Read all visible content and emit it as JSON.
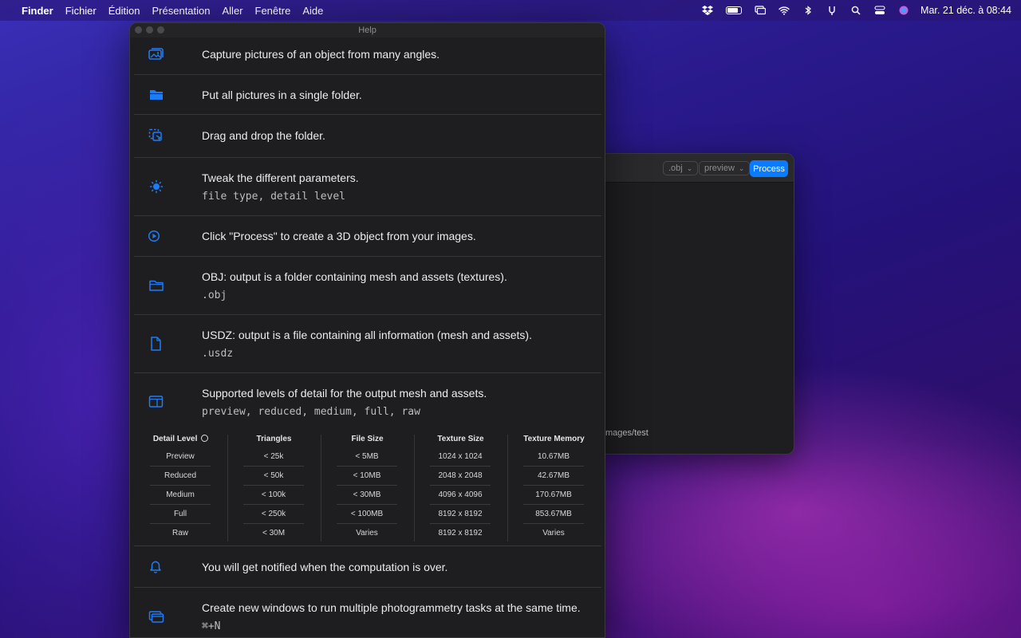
{
  "menubar": {
    "app": "Finder",
    "items": [
      "Fichier",
      "Édition",
      "Présentation",
      "Aller",
      "Fenêtre",
      "Aide"
    ],
    "clock": "Mar. 21 déc. à  08:44",
    "status_icons": [
      "dropbox-icon",
      "battery-icon",
      "screen-mirror-icon",
      "wifi-icon",
      "bluetooth-icon",
      "tuning-fork-icon",
      "spotlight-icon",
      "control-center-icon",
      "siri-icon"
    ]
  },
  "back_window": {
    "format_select": ".obj",
    "detail_select": "preview",
    "process_label": "Process",
    "path_text": "mages/test"
  },
  "help": {
    "title": "Help",
    "rows": [
      {
        "icon": "photos-icon",
        "text": "Capture pictures of an object from many angles.",
        "mono": ""
      },
      {
        "icon": "folder-filled-icon",
        "text": "Put all pictures in a single folder.",
        "mono": ""
      },
      {
        "icon": "drag-drop-icon",
        "text": "Drag and drop the folder.",
        "mono": ""
      },
      {
        "icon": "adjust-icon",
        "text": "Tweak the different parameters.",
        "mono": "file type, detail level"
      },
      {
        "icon": "play-circle-icon",
        "text": "Click \"Process\" to create a 3D object from your images.",
        "mono": ""
      },
      {
        "icon": "folder-outline-icon",
        "text": "OBJ: output is a folder containing mesh and assets (textures).",
        "mono": ".obj"
      },
      {
        "icon": "document-icon",
        "text": "USDZ: output is a file containing all information (mesh and assets).",
        "mono": ".usdz"
      },
      {
        "icon": "layout-icon",
        "text": "Supported levels of detail for the output mesh and assets.",
        "mono": "preview, reduced, medium, full, raw"
      }
    ],
    "table": {
      "headers": [
        "Detail Level",
        "Triangles",
        "File Size",
        "Texture Size",
        "Texture Memory"
      ],
      "rows": [
        [
          "Preview",
          "< 25k",
          "< 5MB",
          "1024 x 1024",
          "10.67MB"
        ],
        [
          "Reduced",
          "< 50k",
          "< 10MB",
          "2048 x 2048",
          "42.67MB"
        ],
        [
          "Medium",
          "< 100k",
          "< 30MB",
          "4096 x 4096",
          "170.67MB"
        ],
        [
          "Full",
          "< 250k",
          "< 100MB",
          "8192 x 8192",
          "853.67MB"
        ],
        [
          "Raw",
          "< 30M",
          "Varies",
          "8192 x 8192",
          "Varies"
        ]
      ]
    },
    "bottom_rows": [
      {
        "icon": "bell-icon",
        "text": "You will get notified when the computation is over.",
        "mono": ""
      },
      {
        "icon": "windows-icon",
        "text": "Create new windows to run multiple photogrammetry tasks at the same time.",
        "mono": "⌘+N"
      }
    ]
  },
  "colors": {
    "accent": "#0a7aff",
    "icon_blue": "#1f7bf5",
    "window_bg": "#1e1e21"
  }
}
